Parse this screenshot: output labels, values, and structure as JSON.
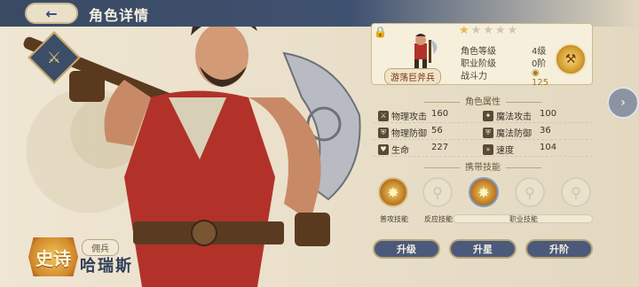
{
  "header": {
    "title": "角色详情",
    "back_icon": "back-arrow-icon"
  },
  "hero": {
    "rarity": "史诗",
    "class_name": "佣兵",
    "name": "哈瑞斯",
    "job_label": "游荡巨斧兵",
    "stars_total": 5,
    "stars_filled": 1
  },
  "info": {
    "level_label": "角色等级",
    "level_value": "4级",
    "rank_label": "职业阶级",
    "rank_value": "0阶",
    "power_label": "战斗力",
    "power_value": "125"
  },
  "attributes": {
    "title": "角色属性",
    "rows": [
      {
        "left_label": "物理攻击",
        "left_value": "160",
        "right_label": "魔法攻击",
        "right_value": "100"
      },
      {
        "left_label": "物理防御",
        "left_value": "56",
        "right_label": "魔法防御",
        "right_value": "36"
      },
      {
        "left_label": "生命",
        "left_value": "227",
        "right_label": "速度",
        "right_value": "104"
      }
    ]
  },
  "skills": {
    "title": "携带技能",
    "labels": {
      "normal": "普攻技能",
      "reaction": "反应技能",
      "job": "职业技能"
    }
  },
  "buttons": {
    "upgrade": "升级",
    "star_up": "升星",
    "rank_up": "升阶"
  },
  "colors": {
    "header_bg": "#3a4a63",
    "accent_gold": "#e6b84a",
    "button_bg": "#4b5a7a"
  }
}
